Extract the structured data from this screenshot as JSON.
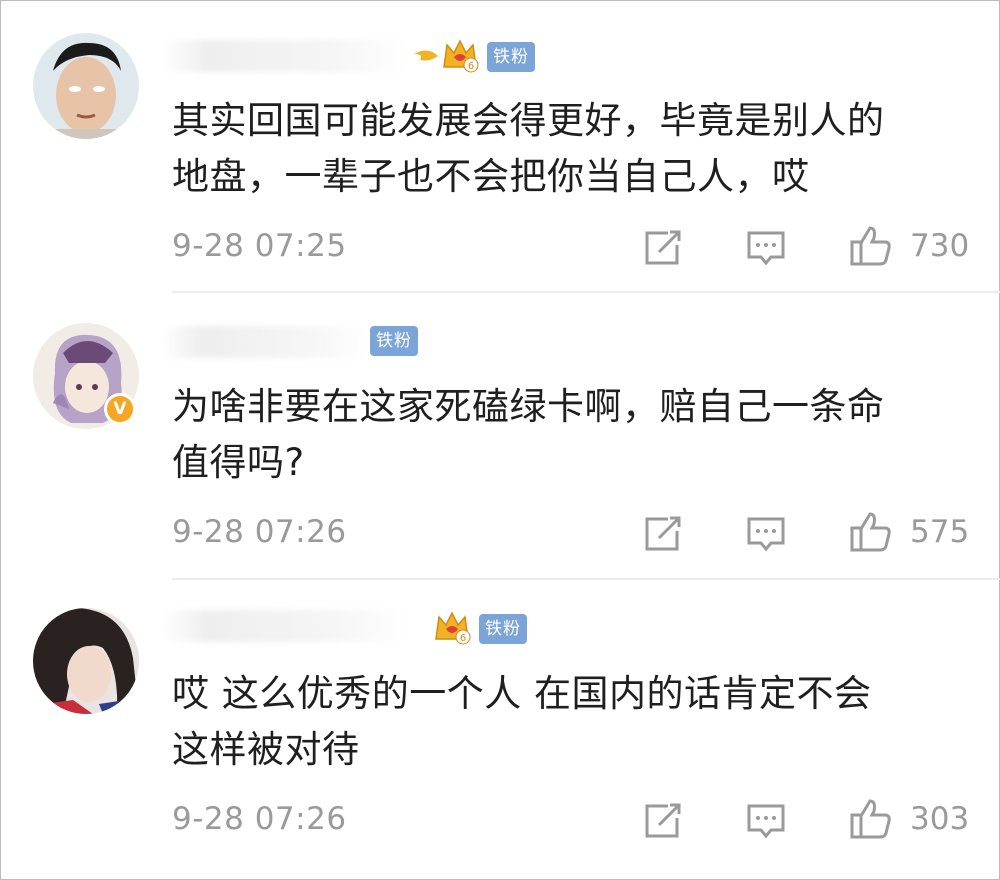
{
  "comments": [
    {
      "fan_label": "铁粉",
      "fan_level": "6",
      "text_lines": [
        "其实回国可能发展会得更好，毕竟是别人的",
        "地盘，一辈子也不会把你当自己人，哎"
      ],
      "time": "9-28 07:25",
      "likes": "730",
      "verified": false
    },
    {
      "fan_label": "铁粉",
      "text_lines": [
        "为啥非要在这家死磕绿卡啊，赔自己一条命",
        "值得吗?"
      ],
      "time": "9-28 07:26",
      "likes": "575",
      "verified": true,
      "verified_mark": "V"
    },
    {
      "fan_label": "铁粉",
      "fan_level": "6",
      "text_lines": [
        "哎 这么优秀的一个人 在国内的话肯定不会",
        "这样被对待"
      ],
      "time": "9-28 07:26",
      "likes": "303",
      "verified": false
    }
  ],
  "icons": {
    "share": "share-icon",
    "comment": "comment-icon",
    "like": "like-icon",
    "crown": "crown-icon"
  },
  "colors": {
    "fan_badge": "#7ba4d8",
    "crown": "#f0b323",
    "verified": "#f5a623",
    "meta_text": "#9a9a9a"
  }
}
